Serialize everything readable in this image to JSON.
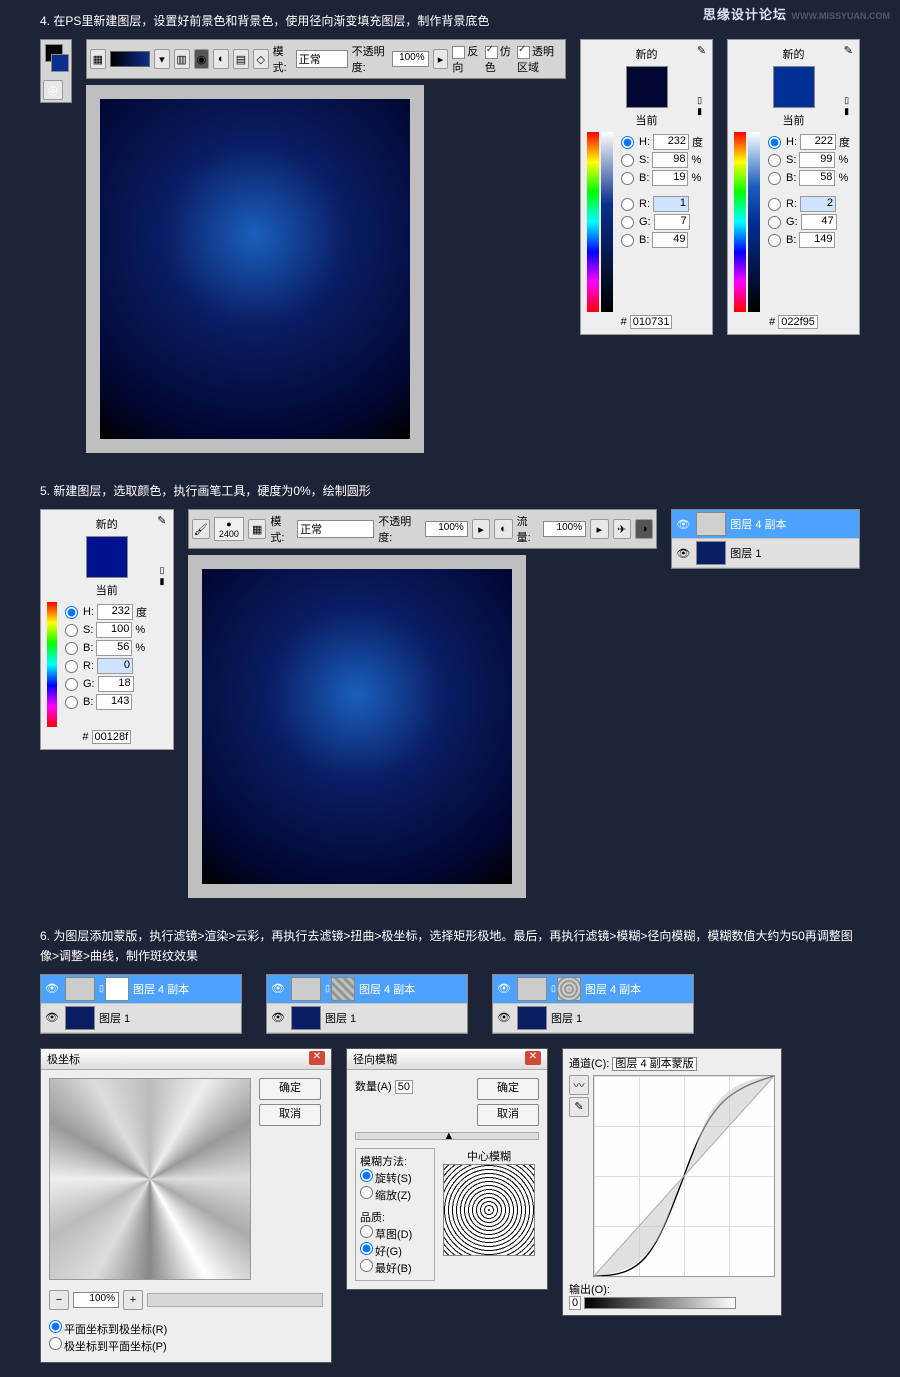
{
  "watermark": {
    "text": "思缘设计论坛",
    "url": "WWW.MISSYUAN.COM"
  },
  "step4": {
    "text": "4. 在PS里新建图层，设置好前景色和背景色，使用径向渐变填充图层，制作背景底色",
    "mode_label": "模式:",
    "mode_value": "正常",
    "opac_label": "不透明度:",
    "opac_value": "100%",
    "reverse": "反向",
    "dither": "仿色",
    "trans": "透明区域"
  },
  "picker": {
    "new": "新的",
    "current": "当前",
    "H": "H:",
    "S": "S:",
    "B": "B:",
    "R": "R:",
    "G": "G:",
    "Bl": "B:",
    "deg": "度",
    "pct": "%",
    "hash": "#"
  },
  "color1": {
    "swatch": "#010731",
    "h": "232",
    "s": "98",
    "b": "19",
    "r": "1",
    "g": "7",
    "bl": "49",
    "hex": "010731"
  },
  "color2": {
    "swatch": "#022f95",
    "h": "222",
    "s": "99",
    "b": "58",
    "r": "2",
    "g": "47",
    "bl": "149",
    "hex": "022f95"
  },
  "step5": {
    "text": "5. 新建图层，选取颜色，执行画笔工具，硬度为0%，绘制圆形",
    "brush_size": "2400",
    "mode_label": "模式:",
    "mode_value": "正常",
    "opac_label": "不透明度:",
    "opac_value": "100%",
    "flow_label": "流量:",
    "flow_value": "100%"
  },
  "color3": {
    "swatch": "#00128f",
    "h": "232",
    "s": "100",
    "b": "56",
    "r": "0",
    "g": "18",
    "bl": "143",
    "hex": "00128f"
  },
  "layer_names": {
    "copy4": "图层 4 副本",
    "layer1": "图层 1"
  },
  "step6": {
    "text": "6. 为图层添加蒙版，执行滤镜>渲染>云彩，再执行去滤镜>扭曲>极坐标，选择矩形极地。最后，再执行滤镜>模糊>径向模糊，模糊数值大约为50再调整图像>调整>曲线，制作斑纹效果"
  },
  "polar": {
    "title": "极坐标",
    "ok": "确定",
    "cancel": "取消",
    "zoom": "100%",
    "opt1": "平面坐标到极坐标(R)",
    "opt2": "极坐标到平面坐标(P)"
  },
  "radial": {
    "title": "径向模糊",
    "ok": "确定",
    "cancel": "取消",
    "amount_label": "数量(A)",
    "amount_value": "50",
    "method": "模糊方法:",
    "spin": "旋转(S)",
    "zoom": "缩放(Z)",
    "quality": "品质:",
    "draft": "草图(D)",
    "good": "好(G)",
    "best": "最好(B)",
    "center": "中心模糊"
  },
  "curves": {
    "channel": "通道(C):",
    "channel_val": "图层 4 副本蒙版",
    "output": "输出(O):",
    "output_val": "0"
  }
}
